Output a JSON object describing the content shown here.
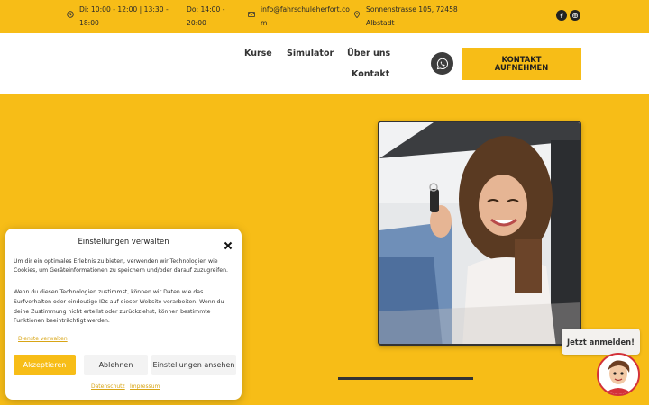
{
  "topbar": {
    "hours1": "Di: 10:00 - 12:00 | 13:30 -\n18:00",
    "hours2": "Do: 14:00 -\n20:00",
    "email": "info@fahrschuleherfort.co\nm",
    "address": "Sonnenstrasse 105, 72458\nAlbstadt",
    "social": [
      "facebook-icon",
      "instagram-icon"
    ]
  },
  "nav": {
    "kurse": "Kurse",
    "simulator": "Simulator",
    "ueber": "Über uns",
    "kontakt": "Kontakt",
    "cta": "KONTAKT\nAUFNEHMEN"
  },
  "consent": {
    "title": "Einstellungen verwalten",
    "text1": "Um dir ein optimales Erlebnis zu bieten, verwenden wir Technologien wie Cookies, um Geräteinformationen zu speichern und/oder darauf zuzugreifen.",
    "text2": "Wenn du diesen Technologien zustimmst, können wir Daten wie das Surfverhalten oder eindeutige IDs auf dieser Website verarbeiten. Wenn du deine Zustimmung nicht erteilst oder zurückziehst, können bestimmte Funktionen beeinträchtigt werden.",
    "manage_link": "Dienste verwalten",
    "accept": "Akzeptieren",
    "deny": "Ablehnen",
    "settings": "Einstellungen ansehen",
    "privacy": "Datenschutz",
    "imprint": "Impressum"
  },
  "chat": {
    "bubble": "Jetzt anmelden!"
  },
  "colors": {
    "brand_yellow": "#f7bd17",
    "dark": "#333333"
  }
}
